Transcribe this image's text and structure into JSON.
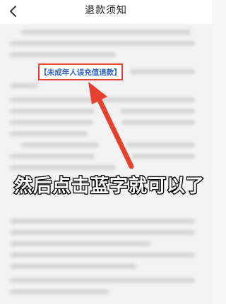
{
  "header": {
    "title": "退款须知",
    "back_icon": "chevron-left-icon"
  },
  "content": {
    "refund_link_label": "【未成年人误充值退款】",
    "highlight_color": "#e8402f",
    "link_color": "#2f63c8"
  },
  "overlay": {
    "caption": "然后点击蓝字就可以了",
    "arrow_color": "#e8402f"
  }
}
